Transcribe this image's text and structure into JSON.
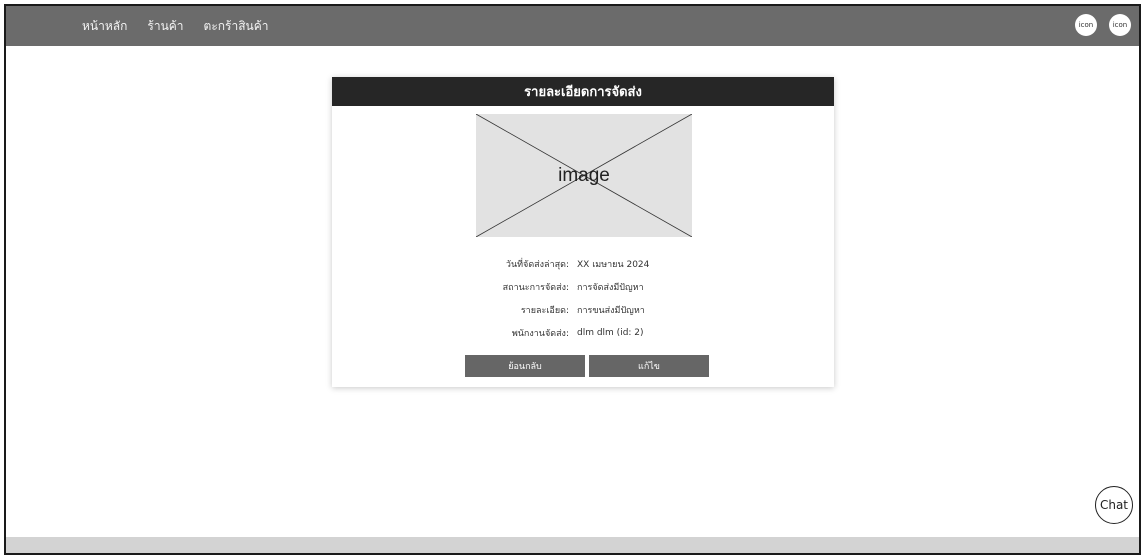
{
  "nav": {
    "links": [
      "หน้าหลัก",
      "ร้านค้า",
      "ตะกร้าสินค้า"
    ],
    "icons": [
      "icon",
      "icon"
    ]
  },
  "card": {
    "title": "รายละเอียดการจัดส่ง",
    "image_label": "image",
    "details": [
      {
        "label": "วันที่จัดส่งล่าสุด:",
        "value": "XX เมษายน 2024"
      },
      {
        "label": "สถานะการจัดส่ง:",
        "value": "การจัดส่งมีปัญหา"
      },
      {
        "label": "รายละเอียด:",
        "value": "การขนส่งมีปัญหา"
      },
      {
        "label": "พนักงานจัดส่ง:",
        "value": "dlm dlm (id: 2)"
      }
    ],
    "back_label": "ย้อนกลับ",
    "edit_label": "แก้ไข"
  },
  "chat_label": "Chat",
  "colors": {
    "navbar": "#6b6b6b",
    "card_header": "#262626",
    "button": "#666666",
    "image_placeholder": "#e2e2e2",
    "footer": "#d3d3d3"
  }
}
